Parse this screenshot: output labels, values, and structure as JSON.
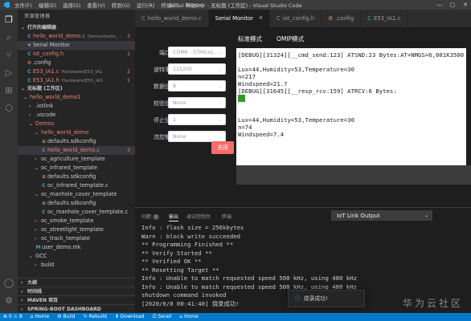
{
  "window": {
    "menu": [
      "文件(F)",
      "编辑(E)",
      "选择(S)",
      "查看(V)",
      "转到(G)",
      "运行(R)",
      "终端(T)",
      "帮助(H)"
    ],
    "title": "Serial Monitor - 无标题 (工作区) - Visual Studio Code",
    "controls": {
      "minimize": "—",
      "maximize": "▢",
      "close": "✕"
    }
  },
  "activity_bar": {
    "icons": [
      "files-icon",
      "search-icon",
      "source-control-icon",
      "run-debug-icon",
      "extensions-icon",
      "iot-icon",
      "account-icon",
      "settings-icon"
    ]
  },
  "sidebar": {
    "title": "资源管理器",
    "open_editors_header": "打开的编辑器",
    "open_editors": [
      {
        "icon": "C",
        "name": "hello_world_demo.c",
        "path": "Demos\\hello_...",
        "badge": "3",
        "color": "red"
      },
      {
        "icon": "✕",
        "name": "Serial Monitor",
        "path": "",
        "badge": "",
        "color": "normal"
      },
      {
        "icon": "C",
        "name": "iot_config.h",
        "path": "",
        "badge": "1",
        "color": "red"
      },
      {
        "icon": "⚙",
        "name": ".config",
        "path": "",
        "badge": "",
        "color": "normal"
      },
      {
        "icon": "C",
        "name": "E53_IA1.c",
        "path": "Hardware\\E53_IA1",
        "badge": "2",
        "color": "red"
      },
      {
        "icon": "C",
        "name": "E53_IA1.h",
        "path": "Hardware\\E53_IA1",
        "badge": "1",
        "color": "red"
      }
    ],
    "workspace_header": "无标题 (工作区)",
    "tree": [
      {
        "indent": 1,
        "chev": "⌄",
        "icon": "",
        "name": "hello_world_demo1",
        "badge": "",
        "color": "red"
      },
      {
        "indent": 2,
        "chev": "›",
        "icon": "",
        "name": ".iotlink",
        "badge": "",
        "color": "normal"
      },
      {
        "indent": 2,
        "chev": "›",
        "icon": "",
        "name": ".vscode",
        "badge": "",
        "color": "normal"
      },
      {
        "indent": 2,
        "chev": "⌄",
        "icon": "",
        "name": "Demos",
        "badge": "",
        "color": "red"
      },
      {
        "indent": 3,
        "chev": "⌄",
        "icon": "",
        "name": "hello_world_demo",
        "badge": "",
        "color": "red"
      },
      {
        "indent": 4,
        "chev": "",
        "icon": "≡",
        "name": "defaults.sdkconfig",
        "badge": "",
        "color": "normal"
      },
      {
        "indent": 4,
        "chev": "",
        "icon": "C",
        "name": "hello_world_demo.c",
        "badge": "3",
        "color": "red",
        "selected": true
      },
      {
        "indent": 3,
        "chev": "›",
        "icon": "",
        "name": "oc_agriculture_template",
        "badge": "",
        "color": "normal"
      },
      {
        "indent": 3,
        "chev": "⌄",
        "icon": "",
        "name": "oc_infrared_template",
        "badge": "",
        "color": "normal"
      },
      {
        "indent": 4,
        "chev": "",
        "icon": "≡",
        "name": "defaults.sdkconfig",
        "badge": "",
        "color": "normal"
      },
      {
        "indent": 4,
        "chev": "",
        "icon": "C",
        "name": "oc_infrared_template.c",
        "badge": "",
        "color": "normal"
      },
      {
        "indent": 3,
        "chev": "⌄",
        "icon": "",
        "name": "oc_manhole_cover_template",
        "badge": "",
        "color": "normal"
      },
      {
        "indent": 4,
        "chev": "",
        "icon": "≡",
        "name": "defaults.sdkconfig",
        "badge": "",
        "color": "normal"
      },
      {
        "indent": 4,
        "chev": "",
        "icon": "C",
        "name": "oc_manhole_cover_template.c",
        "badge": "",
        "color": "normal"
      },
      {
        "indent": 3,
        "chev": "›",
        "icon": "",
        "name": "oc_smoke_template",
        "badge": "",
        "color": "normal"
      },
      {
        "indent": 3,
        "chev": "›",
        "icon": "",
        "name": "oc_streetlight_template",
        "badge": "",
        "color": "normal"
      },
      {
        "indent": 3,
        "chev": "›",
        "icon": "",
        "name": "oc_track_template",
        "badge": "",
        "color": "normal"
      },
      {
        "indent": 3,
        "chev": "",
        "icon": "M",
        "name": "user_demo.mk",
        "badge": "",
        "color": "normal"
      },
      {
        "indent": 2,
        "chev": "⌄",
        "icon": "",
        "name": "GCC",
        "badge": "",
        "color": "normal"
      },
      {
        "indent": 3,
        "chev": "›",
        "icon": "",
        "name": "build",
        "badge": "",
        "color": "normal"
      }
    ],
    "bottom_sections": [
      "大纲",
      "时间线",
      "MAVEN 项目",
      "SPRING-BOOT DASHBOARD"
    ]
  },
  "tabs": [
    {
      "icon": "C",
      "label": "hello_world_demo.c",
      "active": false
    },
    {
      "icon": "",
      "label": "Serial Monitor",
      "active": true
    },
    {
      "icon": "C",
      "label": "iot_config.h",
      "active": false
    },
    {
      "icon": "⚙",
      "label": ".config",
      "active": false
    },
    {
      "icon": "C",
      "label": "E53_IA1.c",
      "active": false
    }
  ],
  "serial_monitor": {
    "fields": [
      {
        "label": "端口",
        "value": "COM6 - STMicro..."
      },
      {
        "label": "波特率",
        "value": "115200"
      },
      {
        "label": "数据位",
        "value": "8"
      },
      {
        "label": "校验位",
        "value": "None"
      },
      {
        "label": "停止位",
        "value": "1"
      },
      {
        "label": "流控制",
        "value": "None"
      }
    ],
    "close_button": "关闭",
    "view_tabs": [
      "标准模式",
      "OMIP模式"
    ],
    "received_lines": [
      "[DEBUG][31324][__cmd_send:123] ATSND:23 Bytes:AT+NMGS=6,001K3500",
      "",
      "Lux=44,Humidity=53,Temperature=30",
      "n=217",
      "Windspeed=21.7",
      "[DEBUG][31645][__resp_rcv:159] ATRCV:6 Bytes:",
      "OK",
      "",
      "",
      "Lux=44,Humidity=53,Temperature=30",
      "n=74",
      "Windspeed=7.4"
    ]
  },
  "panel": {
    "tabs": [
      "问题",
      "输出",
      "调试控制台",
      "终端"
    ],
    "problems_badge": "8",
    "active_tab": "输出",
    "channel": "IoT Link Output",
    "output_lines": [
      "Info : flash size = 256kbytes",
      "Warn : block write succeeded",
      "** Programming Finished **",
      "** Verify Started **",
      "** Verified OK **",
      "** Resetting Target **",
      "Info : Unable to match requested speed 500 kHz, using 480 kHz",
      "Info : Unable to match requested speed 500 kHz, using 480 kHz",
      "shutdown command invoked",
      "[2020/6/8 00:41:40] 烧录成功!"
    ],
    "toast": "烧录成功!",
    "watermark": "华为云社区"
  },
  "statusbar": {
    "items": [
      "⊗ 0 ⚠ 8",
      "⌂ Home",
      "⚙ Build",
      "↻ Rebuild",
      "⬇ Download",
      "⎚ Serail",
      "⌂ Home"
    ]
  },
  "colors": {
    "accent": "#007acc",
    "close_button": "#f56c6c",
    "error": "#e8836f"
  }
}
